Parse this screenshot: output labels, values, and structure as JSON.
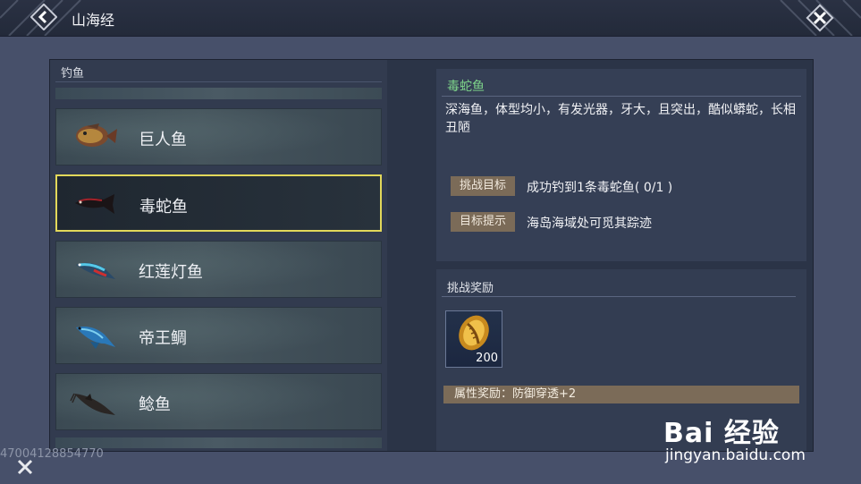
{
  "header": {
    "title": "山海经",
    "back_icon": "chevron-left-icon",
    "close_icon": "close-icon"
  },
  "fish_list": {
    "section_label": "钓鱼",
    "items": [
      {
        "name": "巨人鱼",
        "selected": false
      },
      {
        "name": "毒蛇鱼",
        "selected": true
      },
      {
        "name": "红莲灯鱼",
        "selected": false
      },
      {
        "name": "帝王鲷",
        "selected": false
      },
      {
        "name": "鲶鱼",
        "selected": false
      }
    ]
  },
  "detail": {
    "fish_title": "毒蛇鱼",
    "description": "深海鱼，体型均小，有发光器，牙大，且突出，酷似蟒蛇，长相丑陋",
    "challenge_label": "挑战目标",
    "challenge_text": "成功钓到1条毒蛇鱼( 0/1 )",
    "hint_label": "目标提示",
    "hint_text": "海岛海域处可觅其踪迹"
  },
  "reward": {
    "title": "挑战奖励",
    "item_icon": "golden-shell-icon",
    "item_count": "200",
    "attribute_text": "属性奖励：防御穿透+2"
  },
  "footer": {
    "id_text": "47004128854770"
  },
  "watermark": {
    "brand": "Bai 经验",
    "url": "jingyan.baidu.com"
  },
  "colors": {
    "selected_border": "#e2d85a",
    "fish_title": "#7fd68b",
    "tag_bg": "#7b6b58"
  }
}
